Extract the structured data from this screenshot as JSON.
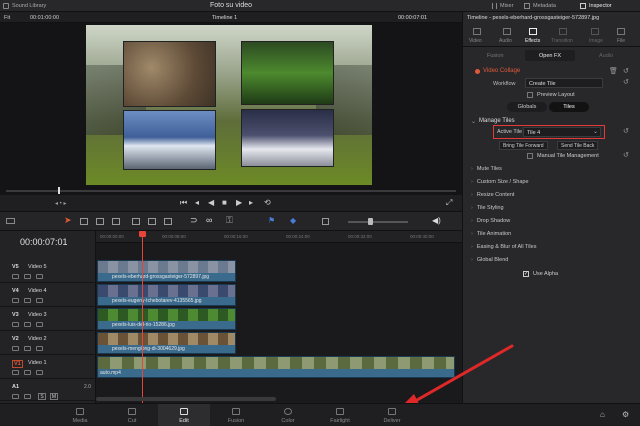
{
  "topbar": {
    "sound_library": "Sound Library",
    "title": "Foto su video",
    "mixer": "Mixer",
    "metadata": "Metadata",
    "inspector": "Inspector"
  },
  "viewer_bar": {
    "fit": "Fit",
    "timecode_left": "00:01:00:00",
    "timeline_name": "Timeline 1",
    "timecode_right": "00:00:07:01"
  },
  "inspector": {
    "clip_title": "Timeline - pexels-eberhard-grossgasteiger-572897.jpg",
    "tabs": [
      "Video",
      "Audio",
      "Effects",
      "Transition",
      "Image",
      "File"
    ],
    "subtabs": [
      "Fusion",
      "Open FX",
      "Audio"
    ],
    "effect_name": "Video Collage",
    "workflow_label": "Workflow",
    "workflow_value": "Create Tile",
    "preview_layout": "Preview Layout",
    "globals": "Globals",
    "tiles": "Tiles",
    "manage_tiles": "Manage Tiles",
    "active_tile_label": "Active Tile",
    "active_tile_value": "Tile 4",
    "bring_forward": "Bring Tile Forward",
    "send_back": "Send Tile Back",
    "manual_tile": "Manual Tile Management",
    "sections": [
      "Mute Tiles",
      "Custom Size / Shape",
      "Resize Content",
      "Tile Styling",
      "Drop Shadow",
      "Tile Animation",
      "Easing & Blur of All Tiles",
      "Global Blend"
    ],
    "use_alpha": "Use Alpha"
  },
  "timeline": {
    "timecode": "00:00:07:01",
    "ruler": [
      "00:00:00:00",
      "00:00:08:00",
      "00:00:16:00",
      "00:00:24:00",
      "00:00:32:00",
      "00:00:40:00"
    ],
    "tracks": [
      {
        "id": "V5",
        "name": "Video 5",
        "clip": "pexels-eberhard-grossgasteiger-572897.jpg",
        "color": "#3a6a8c"
      },
      {
        "id": "V4",
        "name": "Video 4",
        "clip": "pexels-eugeny-tchebotarev-4135565.jpg",
        "color": "#3a6a8c"
      },
      {
        "id": "V3",
        "name": "Video 3",
        "clip": "pexels-luis-del-rio-15286.jpg",
        "color": "#3a6a8c"
      },
      {
        "id": "V2",
        "name": "Video 2",
        "clip": "pexels-menglong-di-3004629.jpg",
        "color": "#3a6a8c"
      },
      {
        "id": "V1",
        "name": "Video 1",
        "clip": "auto.mp4",
        "color": "#3a6a8c"
      }
    ],
    "audio_track": {
      "id": "A1",
      "level": "2.0"
    }
  },
  "bottom_tabs": [
    "Media",
    "Cut",
    "Edit",
    "Fusion",
    "Color",
    "Fairlight",
    "Deliver"
  ]
}
